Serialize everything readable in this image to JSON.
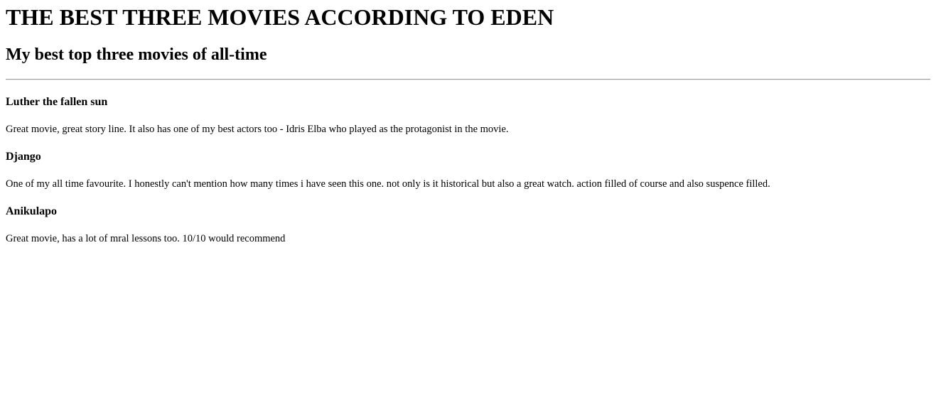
{
  "header": {
    "title": "THE BEST THREE MOVIES ACCORDING TO EDEN",
    "subtitle": "My best top three movies of all-time"
  },
  "movies": [
    {
      "title": "Luther the fallen sun",
      "description": "Great movie, great story line. It also has one of my best actors too - Idris Elba who played as the protagonist in the movie."
    },
    {
      "title": "Django",
      "description": "One of my all time favourite. I honestly can't mention how many times i have seen this one. not only is it historical but also a great watch. action filled of course and also suspence filled."
    },
    {
      "title": "Anikulapo",
      "description": "Great movie, has a lot of mral lessons too. 10/10 would recommend"
    }
  ]
}
